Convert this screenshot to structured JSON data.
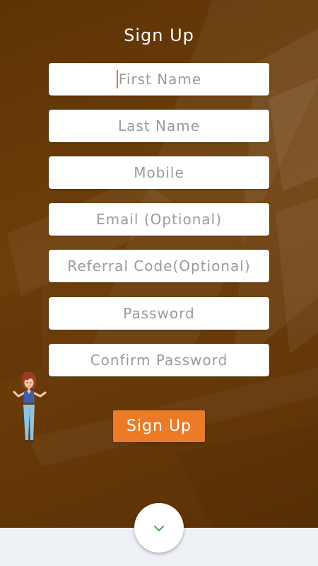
{
  "header": {
    "title": "Sign Up"
  },
  "form": {
    "fields": [
      {
        "placeholder": "First Name",
        "focused": true
      },
      {
        "placeholder": "Last Name"
      },
      {
        "placeholder": "Mobile"
      },
      {
        "placeholder": "Email (Optional)"
      },
      {
        "placeholder": "Referral Code(Optional)"
      },
      {
        "placeholder": "Password"
      },
      {
        "placeholder": "Confirm Password"
      }
    ],
    "submit_label": "Sign Up"
  },
  "decorations": {
    "mascot": "cartoon-girl-shrugging",
    "scroll_icon": "chevron-down-icon"
  },
  "colors": {
    "background": "#6b3c08",
    "accent": "#ec7b28",
    "field_bg": "#ffffff",
    "placeholder_text": "#9a9a9a",
    "chevron": "#4caf50",
    "bottom_panel": "#eef1f5"
  }
}
